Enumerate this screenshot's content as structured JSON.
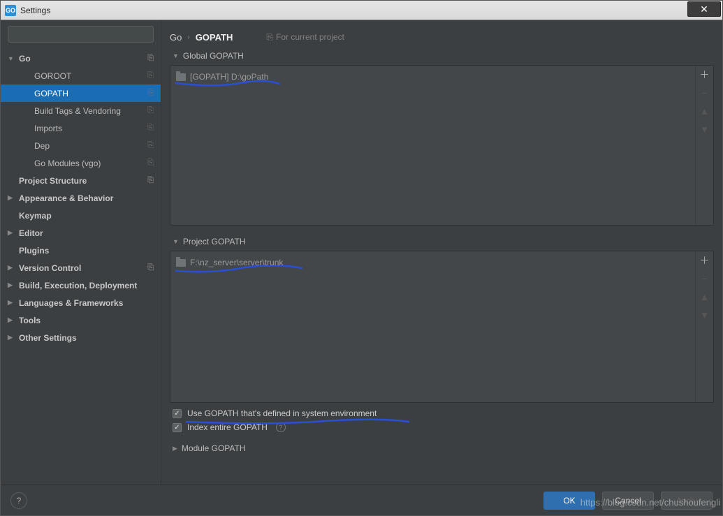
{
  "window": {
    "title": "Settings"
  },
  "search": {
    "placeholder": ""
  },
  "sidebar": {
    "items": [
      {
        "label": "Go",
        "level": 1,
        "arrow": "down",
        "copy": true
      },
      {
        "label": "GOROOT",
        "level": 2,
        "copy": true
      },
      {
        "label": "GOPATH",
        "level": 2,
        "copy": true,
        "selected": true
      },
      {
        "label": "Build Tags & Vendoring",
        "level": 2,
        "copy": true
      },
      {
        "label": "Imports",
        "level": 2,
        "copy": true
      },
      {
        "label": "Dep",
        "level": 2,
        "copy": true
      },
      {
        "label": "Go Modules (vgo)",
        "level": 2,
        "copy": true
      },
      {
        "label": "Project Structure",
        "level": 1,
        "copy": true
      },
      {
        "label": "Appearance & Behavior",
        "level": 1,
        "arrow": "right"
      },
      {
        "label": "Keymap",
        "level": 1
      },
      {
        "label": "Editor",
        "level": 1,
        "arrow": "right"
      },
      {
        "label": "Plugins",
        "level": 1
      },
      {
        "label": "Version Control",
        "level": 1,
        "arrow": "right",
        "copy": true
      },
      {
        "label": "Build, Execution, Deployment",
        "level": 1,
        "arrow": "right"
      },
      {
        "label": "Languages & Frameworks",
        "level": 1,
        "arrow": "right"
      },
      {
        "label": "Tools",
        "level": 1,
        "arrow": "right"
      },
      {
        "label": "Other Settings",
        "level": 1,
        "arrow": "right"
      }
    ]
  },
  "breadcrumb": {
    "root": "Go",
    "current": "GOPATH",
    "forProject": "For current project"
  },
  "sections": {
    "global": {
      "title": "Global GOPATH",
      "entries": [
        "[GOPATH] D:\\goPath"
      ]
    },
    "project": {
      "title": "Project GOPATH",
      "entries": [
        "F:\\nz_server\\server\\trunk"
      ]
    },
    "module": {
      "title": "Module GOPATH"
    }
  },
  "options": {
    "useSystem": "Use GOPATH that's defined in system environment",
    "indexEntire": "Index entire GOPATH"
  },
  "buttons": {
    "ok": "OK",
    "cancel": "Cancel",
    "apply": "Apply"
  },
  "watermark": "https://blog.csdn.net/chushoufengli"
}
